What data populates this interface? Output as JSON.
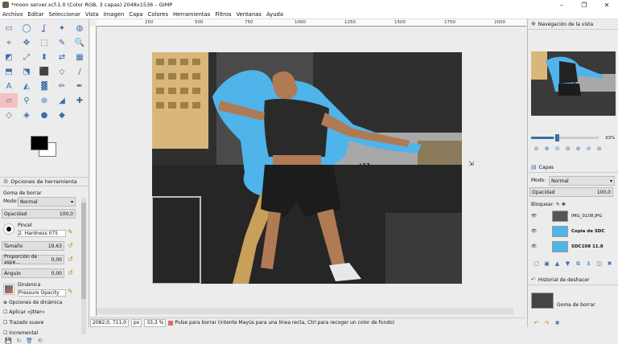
{
  "window": {
    "title": "*moon server.xcf-1.0 (Color RGB, 3 capas) 2048x1536 – GIMP",
    "controls": [
      "–",
      "❐",
      "✕"
    ]
  },
  "menu": [
    "Archivo",
    "Editar",
    "Seleccionar",
    "Vista",
    "Imagen",
    "Capa",
    "Colores",
    "Herramientas",
    "Filtros",
    "Ventanas",
    "Ayuda"
  ],
  "toolbox": {
    "tools": [
      {
        "glyph": "▭"
      },
      {
        "glyph": "◯"
      },
      {
        "glyph": "ʆ"
      },
      {
        "glyph": "✦"
      },
      {
        "glyph": "◍"
      },
      {
        "glyph": "⌖"
      },
      {
        "glyph": "✥"
      },
      {
        "glyph": "⬚"
      },
      {
        "glyph": "✎"
      },
      {
        "glyph": "🔍"
      },
      {
        "glyph": "◩"
      },
      {
        "glyph": "⤢"
      },
      {
        "glyph": "⬍"
      },
      {
        "glyph": "⇄"
      },
      {
        "glyph": "▦"
      },
      {
        "glyph": "⬒"
      },
      {
        "glyph": "⬔"
      },
      {
        "glyph": "⬛"
      },
      {
        "glyph": "⬦"
      },
      {
        "glyph": "/"
      },
      {
        "glyph": "A"
      },
      {
        "glyph": "◭"
      },
      {
        "glyph": "▓"
      },
      {
        "glyph": "✏"
      },
      {
        "glyph": "✒"
      },
      {
        "glyph": "▱"
      },
      {
        "glyph": "⚲"
      },
      {
        "glyph": "⊛"
      },
      {
        "glyph": "◢"
      },
      {
        "glyph": "✚"
      },
      {
        "glyph": "◇"
      },
      {
        "glyph": "◈"
      },
      {
        "glyph": "●"
      },
      {
        "glyph": "◆"
      }
    ],
    "selected_index": 25
  },
  "tool_options": {
    "tab": "Opciones de herramienta",
    "tool_name": "Goma de borrar",
    "mode_label": "Modo:",
    "mode_value": "Normal",
    "opacity_label": "Opacidad",
    "opacity_value": "100,0",
    "brush_label": "Pincel",
    "brush_value": "2. Hardness 075",
    "size_label": "Tamaño",
    "size_value": "19,63",
    "aspect_label": "Proporción de aspe...",
    "aspect_value": "0,00",
    "angle_label": "Ángulo",
    "angle_value": "0,00",
    "dynamics_label": "Dinámica",
    "dynamics_value": "Pressure Opacity",
    "dynamics_options": "Opciones de dinámica",
    "jitter": "Aplicar «jitter»",
    "smooth": "Trazado suave",
    "incremental": "Incremental"
  },
  "ruler": {
    "labels": [
      "250",
      "500",
      "750",
      "1000",
      "1250",
      "1500",
      "1750",
      "2000"
    ]
  },
  "status": {
    "coords": "2082,0, 711,0",
    "unit": "px",
    "zoom": "33,3 %",
    "message": "Pulse para borrar (intente Mayús para una línea recta, Ctrl para recoger un color de fondo)"
  },
  "navigation": {
    "title": "Navegación de la vista",
    "zoom": "33%",
    "zoom_fraction": 0.33
  },
  "layers": {
    "tab": "Capas",
    "mode_label": "Modo:",
    "mode_value": "Normal",
    "opacity_label": "Opacidad",
    "opacity_value": "100,0",
    "lock_label": "Bloquear:",
    "items": [
      {
        "name": "IMG_0108.JPG"
      },
      {
        "name": "Copia de SDC"
      },
      {
        "name": "SDC108 11.8"
      }
    ]
  },
  "history": {
    "title": "Historial de deshacer",
    "item": "Goma de borrar"
  },
  "colors": {
    "accent": "#3a6ea8",
    "selection": "#f6c1c1",
    "halo": "#4fb4ea"
  }
}
